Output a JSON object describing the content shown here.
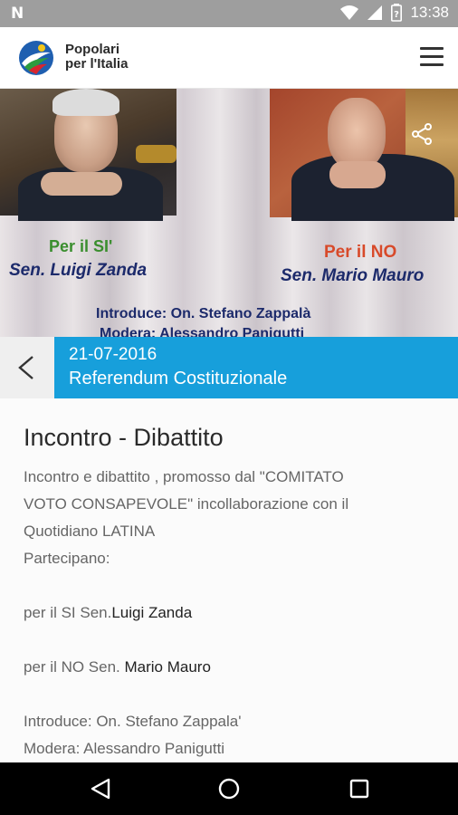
{
  "status_bar": {
    "time": "13:38"
  },
  "app_bar": {
    "brand_line1": "Popolari",
    "brand_line2": "per l'Italia"
  },
  "hero": {
    "per_si": "Per il SI'",
    "si_name": "Sen. Luigi Zanda",
    "per_no": "Per il NO",
    "no_name": "Sen. Mario Mauro",
    "introduce": "Introduce: On. Stefano Zappalà",
    "modera": "Modera: Alessandro Panigutti"
  },
  "event": {
    "date": "21-07-2016",
    "title": "Referendum Costituzionale"
  },
  "article": {
    "title": "Incontro - Dibattito",
    "line1": "Incontro e dibattito , promosso dal \"COMITATO",
    "line2": "VOTO CONSAPEVOLE\" incollaborazione con il",
    "line3": "Quotidiano LATINA",
    "line4": "Partecipano:",
    "si_prefix": "per il SI Sen.",
    "si_name": "Luigi Zanda",
    "no_prefix": "per il NO Sen. ",
    "no_name": "Mario Mauro",
    "introduce": "Introduce: On. Stefano Zappala'",
    "modera": "Modera: Alessandro Panigutti"
  },
  "colors": {
    "accent": "#179fdb",
    "status_bar": "#9e9e9e",
    "nav_bar": "#000000"
  },
  "icons": [
    "notification-n-icon",
    "wifi-icon",
    "signal-icon",
    "battery-icon",
    "menu-icon",
    "share-icon",
    "back-arrow-icon",
    "nav-back-icon",
    "nav-home-icon",
    "nav-recents-icon"
  ]
}
